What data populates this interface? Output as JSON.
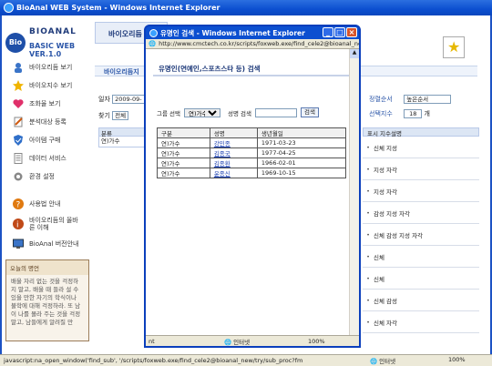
{
  "main_window": {
    "title": "BioAnal WEB System - Windows Internet Explorer"
  },
  "logo": {
    "badge": "Bio",
    "main": "BIOANAL",
    "sub": "BASIC WEB VER.1.0"
  },
  "top_banner": "바이오리듬",
  "nav": [
    {
      "label": "바이오리듬 보기",
      "icon": "person-icon"
    },
    {
      "label": "바이오지수 보기",
      "icon": "star-icon"
    },
    {
      "label": "조화율 보기",
      "icon": "heart-icon"
    },
    {
      "label": "분석대상 등록",
      "icon": "pencil-icon"
    },
    {
      "label": "아이템 구매",
      "icon": "shield-icon"
    },
    {
      "label": "데이터 서비스",
      "icon": "document-icon"
    },
    {
      "label": "환경 설정",
      "icon": "gear-icon"
    },
    {
      "label": "사용법 안내",
      "icon": "question-icon"
    },
    {
      "label": "바이오리듬의 올바른 이해",
      "icon": "info-icon"
    },
    {
      "label": "BioAnal 버전안내",
      "icon": "monitor-icon"
    }
  ],
  "notice": {
    "title": "오늘의 명언",
    "text": "배울 자리 없는 것을 걱정하지 말고, 배울 때 들라 설 수 있을 만한 자기의 학식이나 불학에 대해 걱정하라. 또 남이 나를 몰라 주는 것을 걱정 말고, 남들에게 알려질 만"
  },
  "content": {
    "title": "바이오리듬지",
    "date_label": "일자",
    "date_value": "2009-09-",
    "search_label": "찾기",
    "search_value": "전체",
    "grid_header": "분류",
    "grid_row": "연)가수",
    "grid_row2": "연)가수"
  },
  "right_panel": {
    "sort_label": "정렬순서",
    "sort_value": "높은순서",
    "count_label": "선택지수",
    "count_value": "18",
    "count_unit": "개",
    "table_header": "표시 지수설명",
    "rows": [
      "신체 지성",
      "지성 자각",
      "지성 자각",
      "감성 지성 자각",
      "신체 감성 지성 자각",
      "신체",
      "신체",
      "신체 감성",
      "신체 자각"
    ]
  },
  "main_status": {
    "text": "javascript:na_open_window('find_sub', '/scripts/foxweb.exe/find_cele2@bioanal_new/try/sub_proc?fm",
    "zone": "인터넷",
    "zoom": "100%"
  },
  "popup": {
    "title": "유명인 검색 - Windows Internet Explorer",
    "url": "http://www.cmctech.co.kr/scripts/foxweb.exe/find_cele2@bioanal_new/",
    "heading": "유명인(연예인,스포츠스타 등) 검색",
    "group_label": "그룹 선택",
    "group_value": "연)가수",
    "name_label": "성명 검색",
    "name_value": "",
    "search_button": "검색",
    "columns": [
      "구분",
      "성명",
      "생년월일"
    ],
    "rows": [
      [
        "연)가수",
        "강민종",
        "1971-03-23"
      ],
      [
        "연)가수",
        "김종국",
        "1977-04-25"
      ],
      [
        "연)가수",
        "김종환",
        "1966-02-01"
      ],
      [
        "연)가수",
        "윤종신",
        "1969-10-15"
      ]
    ],
    "status_left": "nt",
    "zone": "인터넷",
    "zoom": "100%"
  },
  "colors": {
    "titlebar": "#0c4fd0",
    "link": "#1a3fb0",
    "accent": "#2b56a8"
  }
}
